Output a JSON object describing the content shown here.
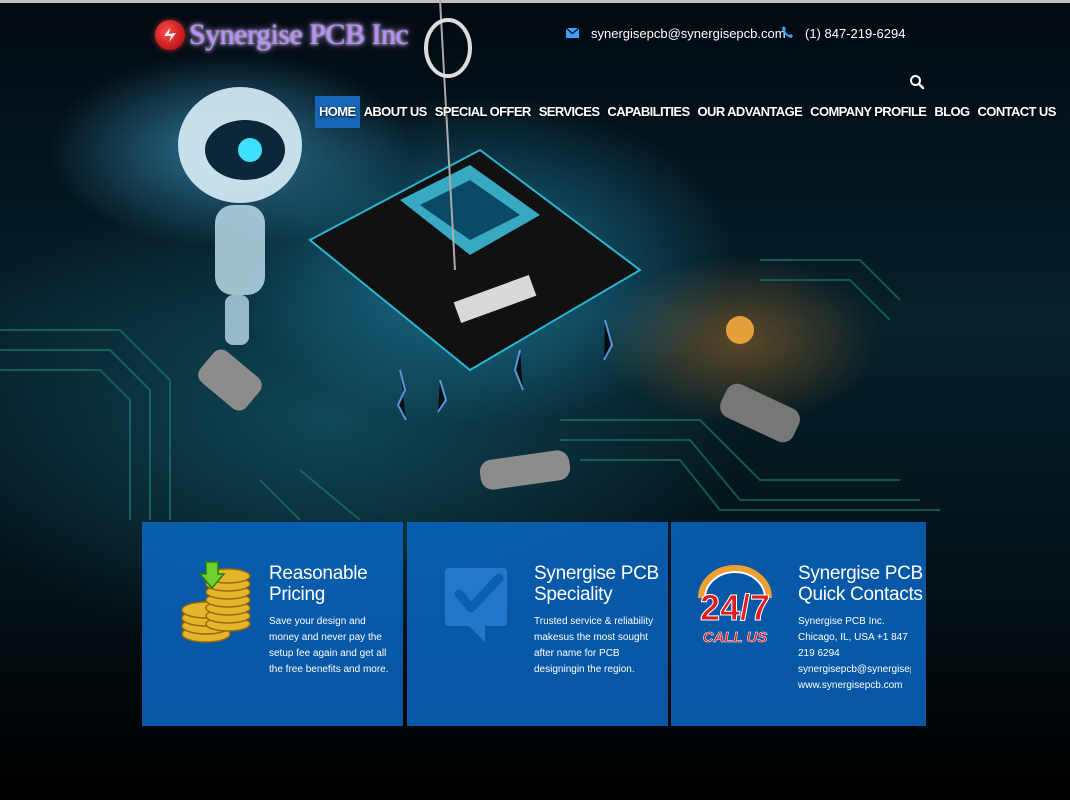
{
  "brand": {
    "name": "Synergise PCB Inc"
  },
  "header": {
    "email": "synergisepcb@synergisepcb.com",
    "phone": "(1) 847-219-6294",
    "email_icon": "envelope-icon",
    "phone_icon": "phone-icon",
    "search_icon": "search-icon"
  },
  "nav": {
    "items": [
      {
        "label": "HOME",
        "active": true
      },
      {
        "label": "ABOUT US"
      },
      {
        "label": "SPECIAL OFFER"
      },
      {
        "label": "SERVICES"
      },
      {
        "label": "CAPABILITIES"
      },
      {
        "label": "OUR ADVANTAGE"
      },
      {
        "label": "COMPANY PROFILE"
      },
      {
        "label": "BLOG"
      },
      {
        "label": "CONTACT US"
      }
    ]
  },
  "cards": [
    {
      "icon": "coins-icon",
      "title_line1": "Reasonable",
      "title_line2": "Pricing",
      "text": "Save your design and money and never pay the setup fee again and get all the free benefits and more."
    },
    {
      "icon": "checkmark-icon",
      "title_line1": "Synergise PCB",
      "title_line2": "Speciality",
      "text": "Trusted service & reliability makesus the most sought after name for PCB designingin the region."
    },
    {
      "icon": "24-7-call-us-icon",
      "badge_text": "24/7",
      "badge_sub": "CALL US",
      "title_line1": "Synergise PCB",
      "title_line2": "Quick Contacts",
      "lines": [
        "Synergise PCB Inc.",
        "Chicago, IL, USA +1 847",
        "219 6294",
        "synergisepcb@synergisepcb.com",
        "www.synergisepcb.com"
      ]
    }
  ],
  "colors": {
    "accent": "#1566b8",
    "card_bg": "#0869c8",
    "logo_text": "#b98cff",
    "icon_blue": "#3aa0ff",
    "badge_red": "#e01b1b"
  }
}
